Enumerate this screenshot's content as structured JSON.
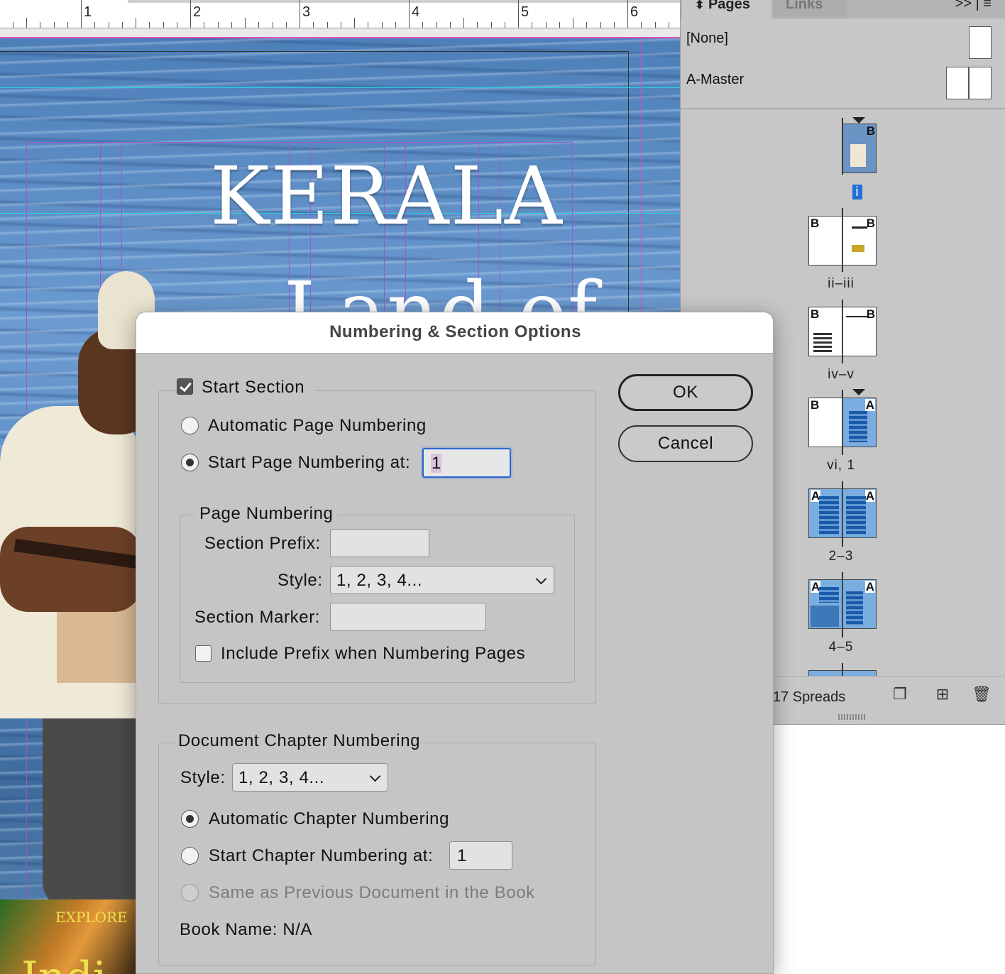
{
  "ruler": {
    "numbers": [
      "1",
      "2",
      "3",
      "4",
      "5",
      "6"
    ]
  },
  "document": {
    "title": "KERALA",
    "subtitle": "Land of",
    "cover_small_title": "EXPLORE",
    "cover_small_big": "Indi"
  },
  "pages_panel": {
    "tabs": {
      "pages": "Pages",
      "links": "Links"
    },
    "panel_menu": ">> | ≡",
    "masters": [
      {
        "label": "[None]"
      },
      {
        "label": "A-Master"
      }
    ],
    "spreads": [
      {
        "label": "i",
        "selected": true
      },
      {
        "label": "ii–iii"
      },
      {
        "label": "iv–v"
      },
      {
        "label": "vi, 1"
      },
      {
        "label": "2–3"
      },
      {
        "label": "4–5"
      }
    ],
    "footer": {
      "spread_count": "17 Spreads"
    },
    "icons": [
      "edit-page-size-icon",
      "new-page-icon",
      "trash-icon"
    ]
  },
  "dialog": {
    "title": "Numbering & Section Options",
    "start_section": {
      "label": "Start Section",
      "checked": true
    },
    "automatic_page_numbering": "Automatic Page Numbering",
    "start_page_numbering_at": {
      "label": "Start Page Numbering at:",
      "value": "1"
    },
    "page_numbering": {
      "group_title": "Page Numbering",
      "section_prefix_label": "Section Prefix:",
      "section_prefix_value": "",
      "style_label": "Style:",
      "style_value": "1, 2, 3, 4...",
      "section_marker_label": "Section Marker:",
      "section_marker_value": "",
      "include_prefix": {
        "label": "Include Prefix when Numbering Pages",
        "checked": false
      }
    },
    "chapter_numbering": {
      "group_title": "Document Chapter Numbering",
      "style_label": "Style:",
      "style_value": "1, 2, 3, 4...",
      "automatic": "Automatic Chapter Numbering",
      "start_at_label": "Start Chapter Numbering at:",
      "start_at_value": "1",
      "same_as_previous": "Same as Previous Document in the Book",
      "book_name": "Book Name: N/A"
    },
    "buttons": {
      "ok": "OK",
      "cancel": "Cancel"
    }
  },
  "colors": {
    "accent": "#2b67d1",
    "guide_purple": "#9b59d0",
    "guide_cyan": "#28d0e0",
    "page_blue": "#7aaee0"
  }
}
